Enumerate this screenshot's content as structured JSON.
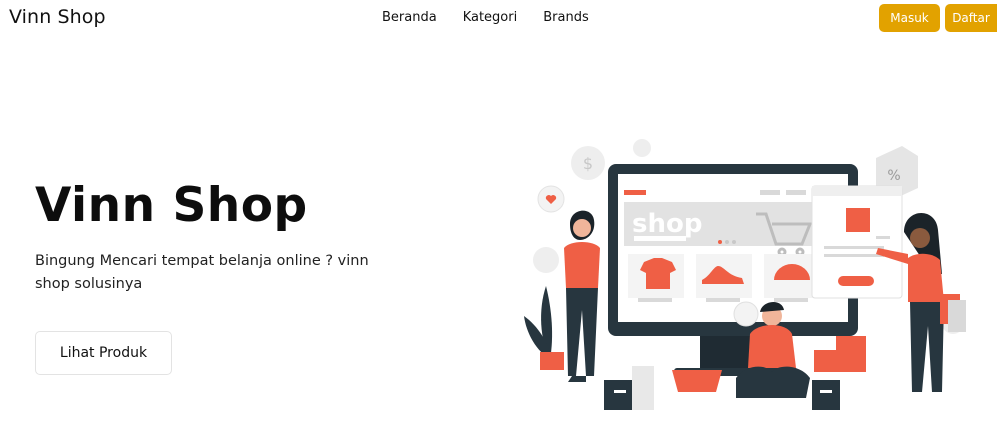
{
  "navbar": {
    "brand": "Vinn Shop",
    "links": [
      "Beranda",
      "Kategori",
      "Brands"
    ],
    "login_label": "Masuk",
    "register_label": "Daftar"
  },
  "hero": {
    "title": "Vinn Shop",
    "subtitle": "Bingung Mencari tempat belanja online ? vinn shop solusinya",
    "cta_label": "Lihat Produk"
  },
  "illustration": {
    "screen_text": "shop",
    "badge_text": "%",
    "colors": {
      "accent": "#e2a200",
      "coral": "#ef5f45",
      "dark": "#27363f",
      "grey": "#d9d9d9"
    }
  }
}
